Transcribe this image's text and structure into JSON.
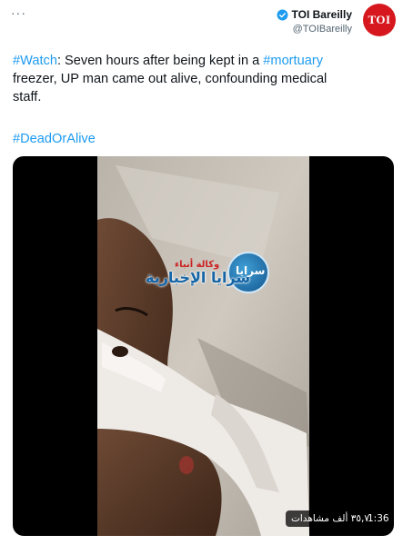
{
  "header": {
    "more_label": "···",
    "display_name": "TOI Bareilly",
    "handle": "@TOIBareilly",
    "verified_icon": "verified-badge-icon",
    "avatar_text": "TOI",
    "colors": {
      "verified": "#1d9bf0",
      "avatar_bg": "#d6181e",
      "hashtag": "#1d9bf0"
    }
  },
  "tweet": {
    "line1_tag1": "#Watch",
    "line1_text": ": Seven hours after being kept in a ",
    "line1_tag2": "#mortuary",
    "line2_text": "freezer, UP man came out alive, confounding medical",
    "line3_text": "staff.",
    "hashtag_line": "#DeadOrAlive"
  },
  "media": {
    "watermark_agency": "وكالة أنباء",
    "watermark_main": "سرايا الإخبارية",
    "watermark_circle": "سرايا",
    "views_label": "٣٥,٧ ألف مشاهدات",
    "duration": "1:36"
  }
}
